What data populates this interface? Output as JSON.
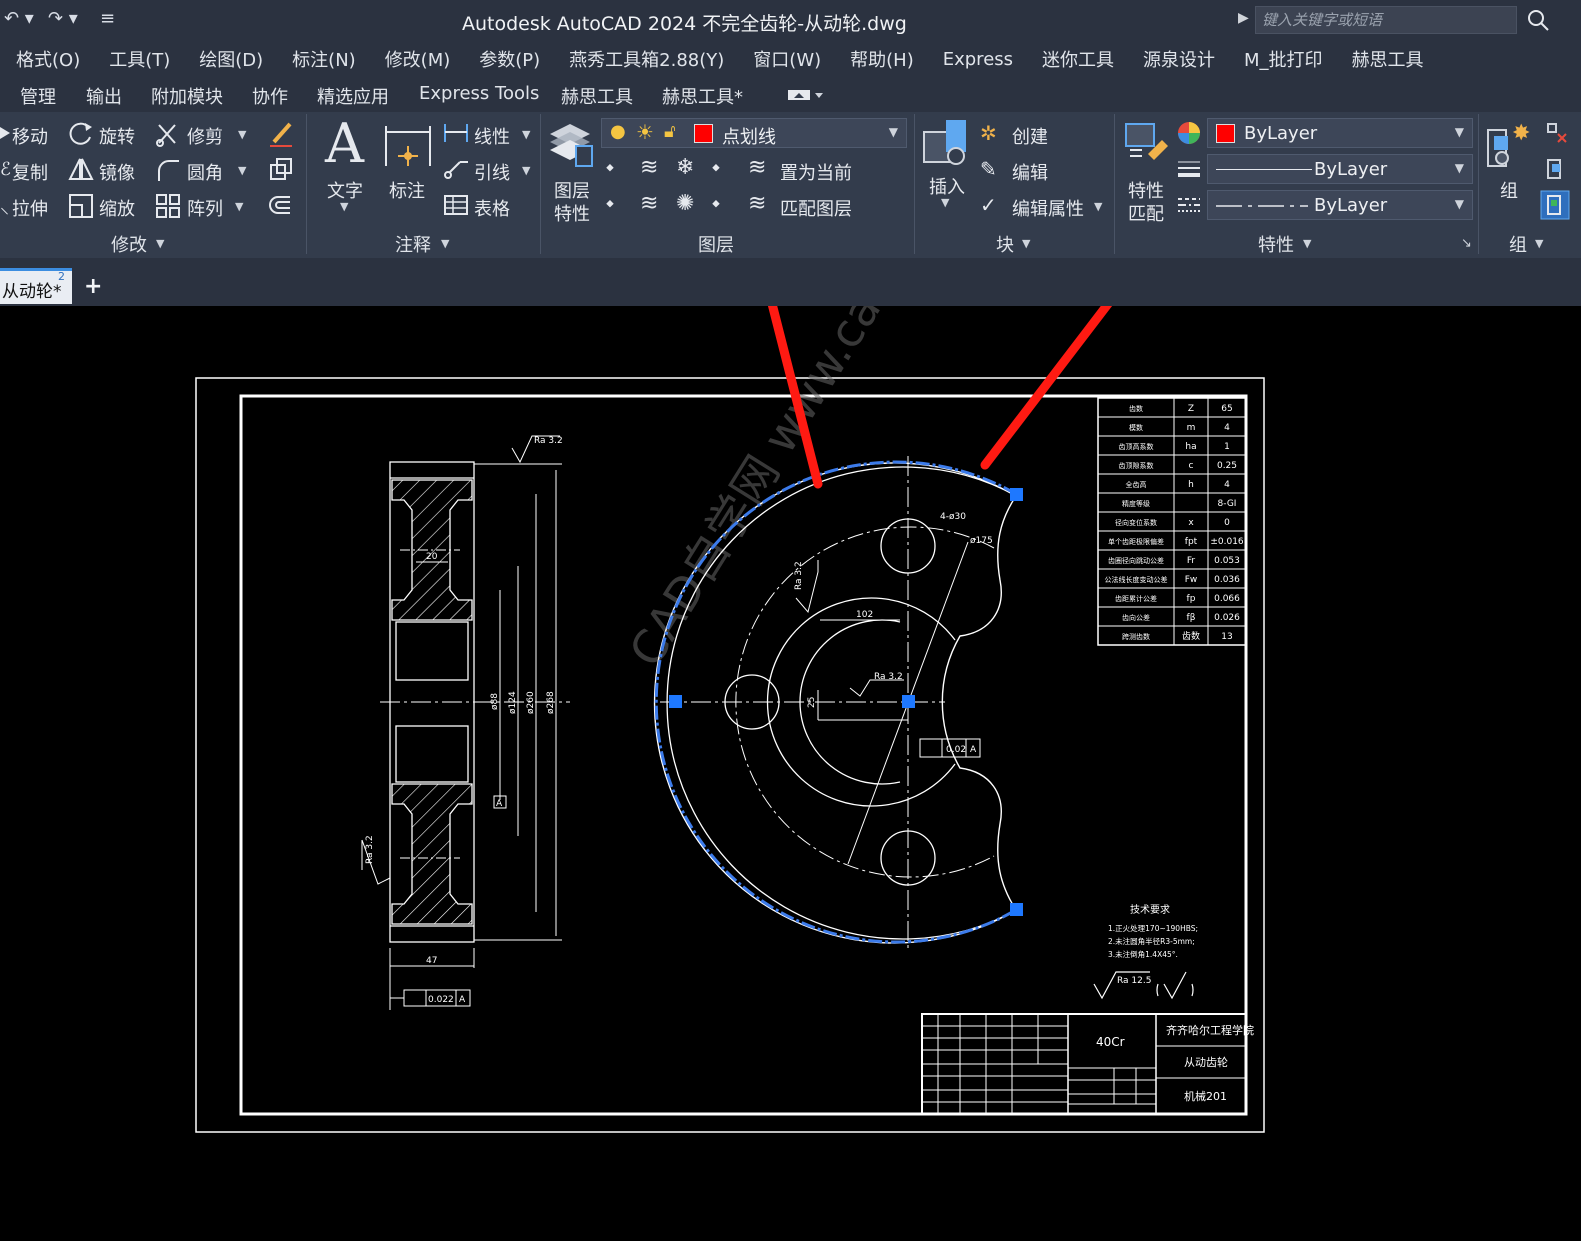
{
  "app": {
    "title": "Autodesk AutoCAD 2024   不完全齿轮-从动轮.dwg",
    "search_placeholder": "键入关键字或短语"
  },
  "menubar": [
    "格式(O)",
    "工具(T)",
    "绘图(D)",
    "标注(N)",
    "修改(M)",
    "参数(P)",
    "燕秀工具箱2.88(Y)",
    "窗口(W)",
    "帮助(H)",
    "Express",
    "迷你工具",
    "源泉设计",
    "M_批打印",
    "赫思工具"
  ],
  "ribbon_tabs": [
    "管理",
    "输出",
    "附加模块",
    "协作",
    "精选应用",
    "Express Tools",
    "赫思工具",
    "赫思工具*"
  ],
  "modify": {
    "title": "修改",
    "move": "移动",
    "rotate": "旋转",
    "trim": "修剪",
    "copy": "复制",
    "mirror": "镜像",
    "fillet": "圆角",
    "stretch": "拉伸",
    "scale": "缩放",
    "array": "阵列"
  },
  "annotation": {
    "title": "注释",
    "text": "文字",
    "dimension": "标注",
    "linear": "线性",
    "leader": "引线",
    "table": "表格"
  },
  "layers": {
    "title": "图层",
    "properties_line1": "图层",
    "properties_line2": "特性",
    "current_layer": "点划线",
    "layer_color": "#ff0000",
    "make_current": "置为当前",
    "match_layer": "匹配图层"
  },
  "block": {
    "title": "块",
    "insert": "插入",
    "create": "创建",
    "edit": "编辑",
    "edit_attributes": "编辑属性"
  },
  "properties": {
    "title": "特性",
    "match_line1": "特性",
    "match_line2": "匹配",
    "color": "ByLayer",
    "lineweight": "ByLayer",
    "linetype": "ByLayer"
  },
  "group": {
    "title": "组",
    "label": "组"
  },
  "document_tab": {
    "label": "从动轮*",
    "badge": "2"
  },
  "drawing": {
    "watermark": "CAD自学网 www.cadzxw.com",
    "gear_table": [
      [
        "齿数",
        "Z",
        "65"
      ],
      [
        "模数",
        "m",
        "4"
      ],
      [
        "齿顶高系数",
        "ha",
        "1"
      ],
      [
        "齿顶隙系数",
        "c",
        "0.25"
      ],
      [
        "全齿高",
        "h",
        "4"
      ],
      [
        "精度等级",
        "",
        "8-GI"
      ],
      [
        "径向变位系数",
        "x",
        "0"
      ],
      [
        "单个齿距极限偏差",
        "fpt",
        "±0.016"
      ],
      [
        "齿圈径向跳动公差",
        "Fr",
        "0.053"
      ],
      [
        "公法线长度变动公差",
        "Fw",
        "0.036"
      ],
      [
        "齿距累计公差",
        "fp",
        "0.066"
      ],
      [
        "齿向公差",
        "fβ",
        "0.026"
      ],
      [
        "跨测齿数",
        "齿数",
        "13"
      ]
    ],
    "tech_title": "技术要求",
    "tech_notes": [
      "1.正火处理170~190HBS;",
      "2.未注圆角半径R3-5mm;",
      "3.未注倒角1.4X45°."
    ],
    "roughness_general": "Ra 12.5",
    "title_block": {
      "material": "40Cr",
      "school": "齐齐哈尔工程学院",
      "part": "从动齿轮",
      "class": "机械201"
    },
    "dims_left": {
      "ra_top": "Ra 3.2",
      "ra_left": "Ra 3.2",
      "w20": "20",
      "w47": "47",
      "d88": "ø88",
      "d124": "ø124",
      "d260": "ø260",
      "d268": "ø268",
      "datum": "A",
      "runout": "0.022",
      "runout_ref": "A"
    },
    "dims_right": {
      "holes": "4-ø30",
      "pcd": "ø175",
      "ra_a": "Ra 3.2",
      "ra_b": "Ra 3.2",
      "d102": "102",
      "d25": "25",
      "flat_tol": "0.02",
      "flat_ref": "A"
    }
  }
}
